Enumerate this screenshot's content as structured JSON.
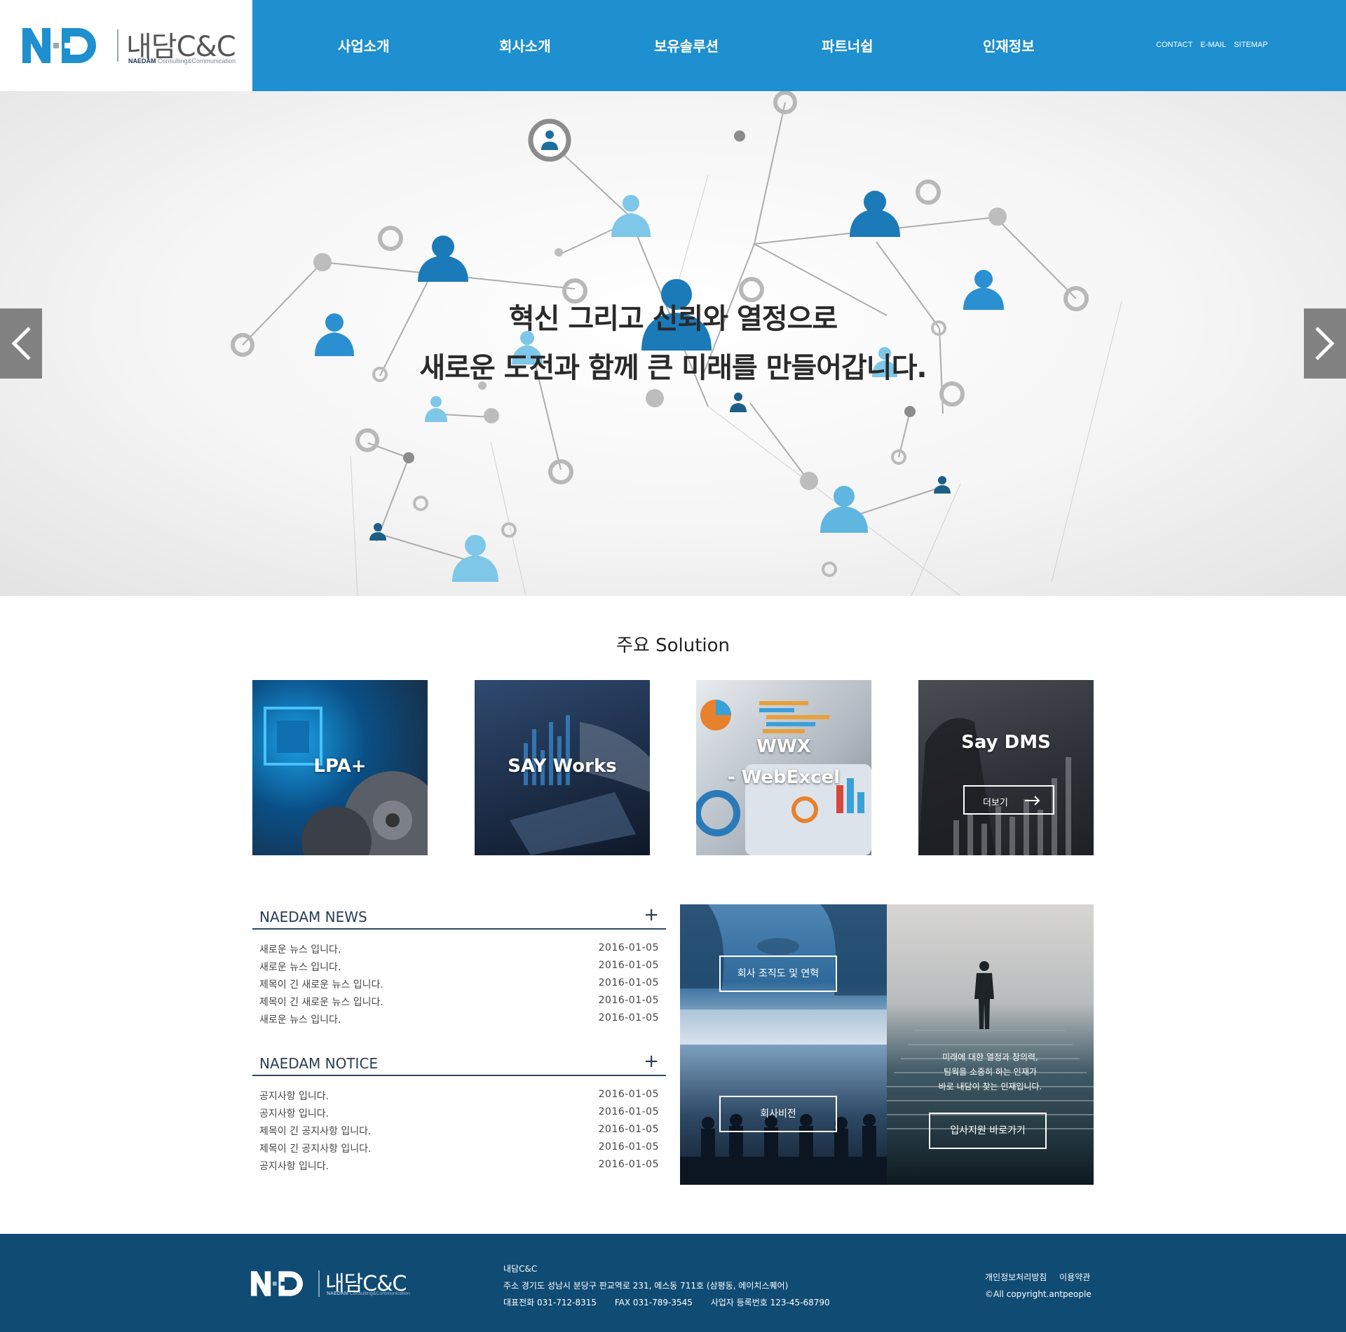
{
  "brand": {
    "name": "내담C&C",
    "tagline_bold": "NAEDAM",
    "tagline": "Consulting&Communication",
    "primary_color": "#1e8fcf",
    "footer_color": "#0f4b73"
  },
  "nav": {
    "items": [
      "사업소개",
      "회사소개",
      "보유솔루션",
      "파트너쉽",
      "인재정보"
    ],
    "util": [
      "CONTACT",
      "E-MAIL",
      "SITEMAP"
    ]
  },
  "hero": {
    "line1": "혁신 그리고 신뢰와 열정으로",
    "line2": "새로운 도전과 함께 큰 미래를 만들어갑니다.",
    "prev_icon": "chevron-left-icon",
    "next_icon": "chevron-right-icon"
  },
  "solutions": {
    "title": "주요 Solution",
    "cards": [
      {
        "label": "LPA+"
      },
      {
        "label": "SAY Works"
      },
      {
        "label_line1": "WWX",
        "label_line2": "- WebExcel"
      },
      {
        "label": "Say DMS",
        "more": "더보기"
      }
    ]
  },
  "news": {
    "title": "NAEDAM NEWS",
    "plus": "+",
    "rows": [
      {
        "title": "새로운 뉴스 입니다.",
        "date": "2016-01-05"
      },
      {
        "title": "새로운 뉴스  입니다.",
        "date": "2016-01-05"
      },
      {
        "title": "제목이 긴 새로운 뉴스  입니다.",
        "date": "2016-01-05"
      },
      {
        "title": "제목이 긴 새로운 뉴스  입니다.",
        "date": "2016-01-05"
      },
      {
        "title": "새로운 뉴스  입니다.",
        "date": "2016-01-05"
      }
    ]
  },
  "notice": {
    "title": "NAEDAM NOTICE",
    "plus": "+",
    "rows": [
      {
        "title": "공지사항 입니다.",
        "date": "2016-01-05"
      },
      {
        "title": "공지사항  입니다.",
        "date": "2016-01-05"
      },
      {
        "title": "제목이 긴 공지사항  입니다.",
        "date": "2016-01-05"
      },
      {
        "title": "제목이 긴 공지사항  입니다.",
        "date": "2016-01-05"
      },
      {
        "title": "공지사항 입니다.",
        "date": "2016-01-05"
      }
    ]
  },
  "tiles": {
    "org": "회사 조직도 및 연혁",
    "vision": "회사비전",
    "recruit_copy": [
      "미래에 대한 열정과 창의력,",
      "팀웍을 소중히 하는 인재가",
      "바로 내담이 찾는 인재입니다."
    ],
    "recruit_button": "입사지원 바로가기"
  },
  "footer": {
    "company": "내담C&C",
    "address": "주소 경기도 성남시 분당구 판교역로 231, 에스동 711호 (삼평동, 에이치스퀘어)",
    "tel": "대표전화 031-712-8315",
    "fax": "FAX 031-789-3545",
    "biz": "사업자 등록번호 123-45-68790",
    "privacy": "개인정보처리방침",
    "terms": "이용약관",
    "copyright": "©All copyright.antpeople"
  }
}
